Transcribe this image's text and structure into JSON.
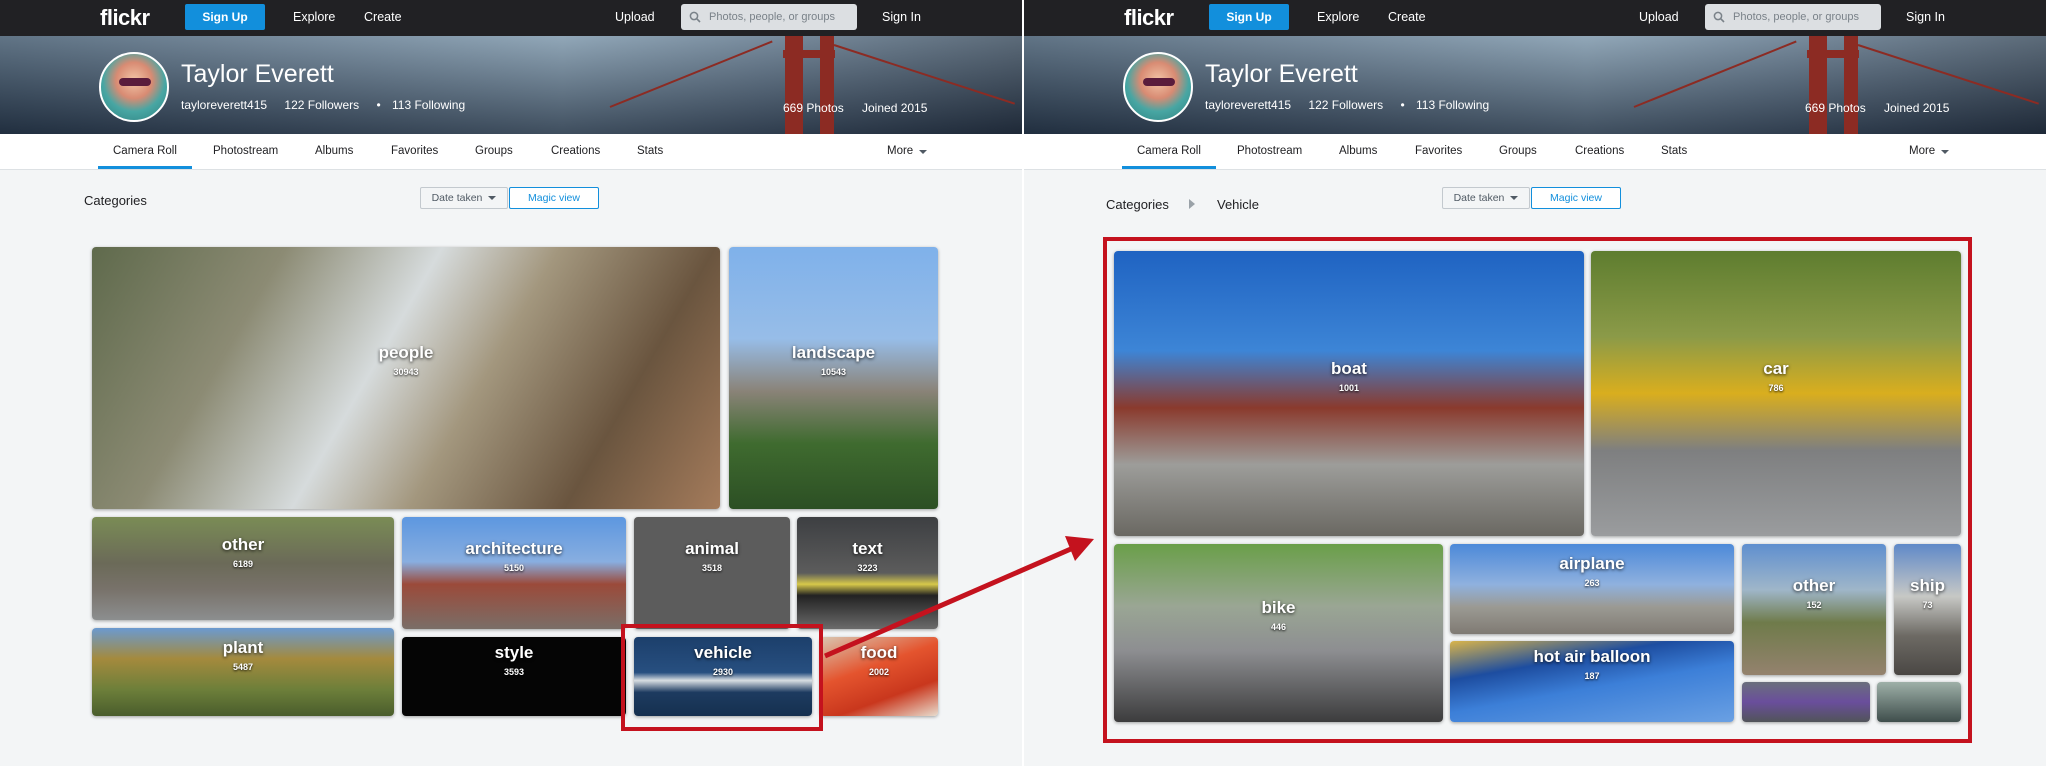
{
  "header": {
    "logo": "flickr",
    "signup_label": "Sign Up",
    "explore_label": "Explore",
    "create_label": "Create",
    "upload_label": "Upload",
    "search_placeholder": "Photos, people, or groups",
    "signin_label": "Sign In"
  },
  "profile": {
    "name": "Taylor Everett",
    "username": "tayloreverett415",
    "followers": "122 Followers",
    "following": "113 Following",
    "separator": "•",
    "photos": "669 Photos",
    "joined": "Joined 2015"
  },
  "subnav": {
    "camera_roll": "Camera Roll",
    "photostream": "Photostream",
    "albums": "Albums",
    "favorites": "Favorites",
    "groups": "Groups",
    "creations": "Creations",
    "stats": "Stats",
    "more": "More"
  },
  "toolbar": {
    "date_taken": "Date taken",
    "magic_view": "Magic view"
  },
  "left_panel": {
    "breadcrumb": "Categories",
    "categories": [
      {
        "label": "people",
        "count": "30943"
      },
      {
        "label": "landscape",
        "count": "10543"
      },
      {
        "label": "other",
        "count": "6189"
      },
      {
        "label": "architecture",
        "count": "5150"
      },
      {
        "label": "animal",
        "count": "3518"
      },
      {
        "label": "text",
        "count": "3223"
      },
      {
        "label": "plant",
        "count": "5487"
      },
      {
        "label": "style",
        "count": "3593"
      },
      {
        "label": "vehicle",
        "count": "2930"
      },
      {
        "label": "food",
        "count": "2002"
      }
    ]
  },
  "right_panel": {
    "breadcrumb_root": "Categories",
    "breadcrumb_current": "Vehicle",
    "categories": [
      {
        "label": "boat",
        "count": "1001"
      },
      {
        "label": "car",
        "count": "786"
      },
      {
        "label": "bike",
        "count": "446"
      },
      {
        "label": "airplane",
        "count": "263"
      },
      {
        "label": "other",
        "count": "152"
      },
      {
        "label": "ship",
        "count": "73"
      },
      {
        "label": "hot air balloon",
        "count": "187"
      }
    ]
  },
  "colors": {
    "brand_blue": "#128fdc",
    "highlight_red": "#c4121e",
    "topbar": "#212124"
  }
}
